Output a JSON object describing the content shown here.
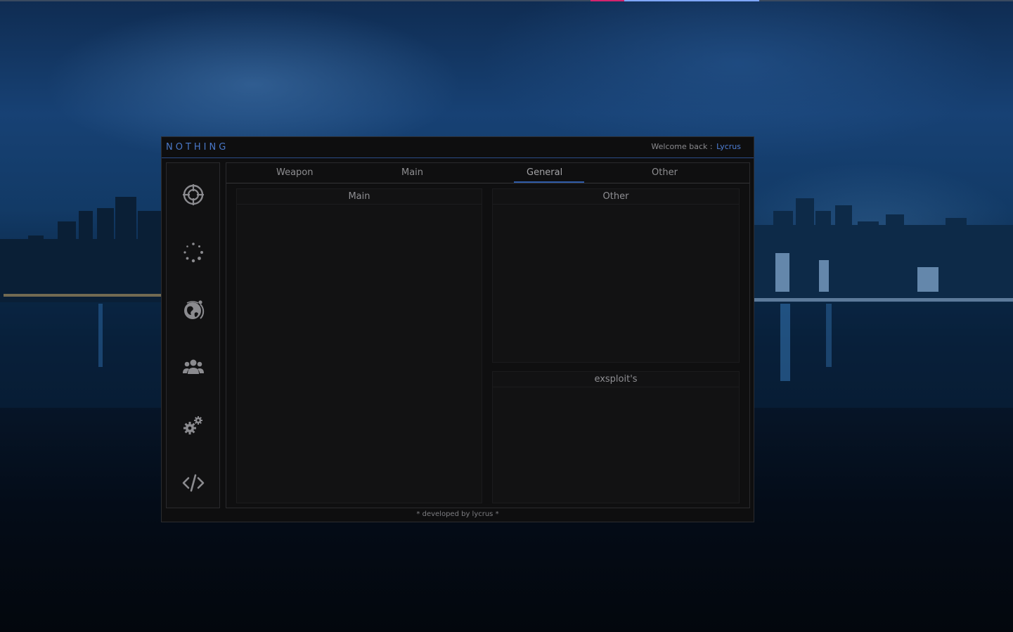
{
  "window": {
    "title": "NOTHING",
    "welcome_text": "Welcome back :",
    "username": "Lycrus",
    "footer": "* developed by lycrus *"
  },
  "sidebar": {
    "items": [
      {
        "icon": "crosshair-icon"
      },
      {
        "icon": "spinner-icon"
      },
      {
        "icon": "globe-icon"
      },
      {
        "icon": "users-icon"
      },
      {
        "icon": "gears-icon"
      },
      {
        "icon": "code-icon"
      }
    ]
  },
  "tabs": [
    {
      "label": "Weapon"
    },
    {
      "label": "Main"
    },
    {
      "label": "General",
      "active": true
    },
    {
      "label": "Other"
    }
  ],
  "panels": {
    "main": {
      "title": "Main"
    },
    "other": {
      "title": "Other"
    },
    "exploits": {
      "title": "exsploit's"
    }
  },
  "colors": {
    "accent": "#4a78c8",
    "tab_underline": "#2f5ba8",
    "username": "#4f7fd6"
  }
}
